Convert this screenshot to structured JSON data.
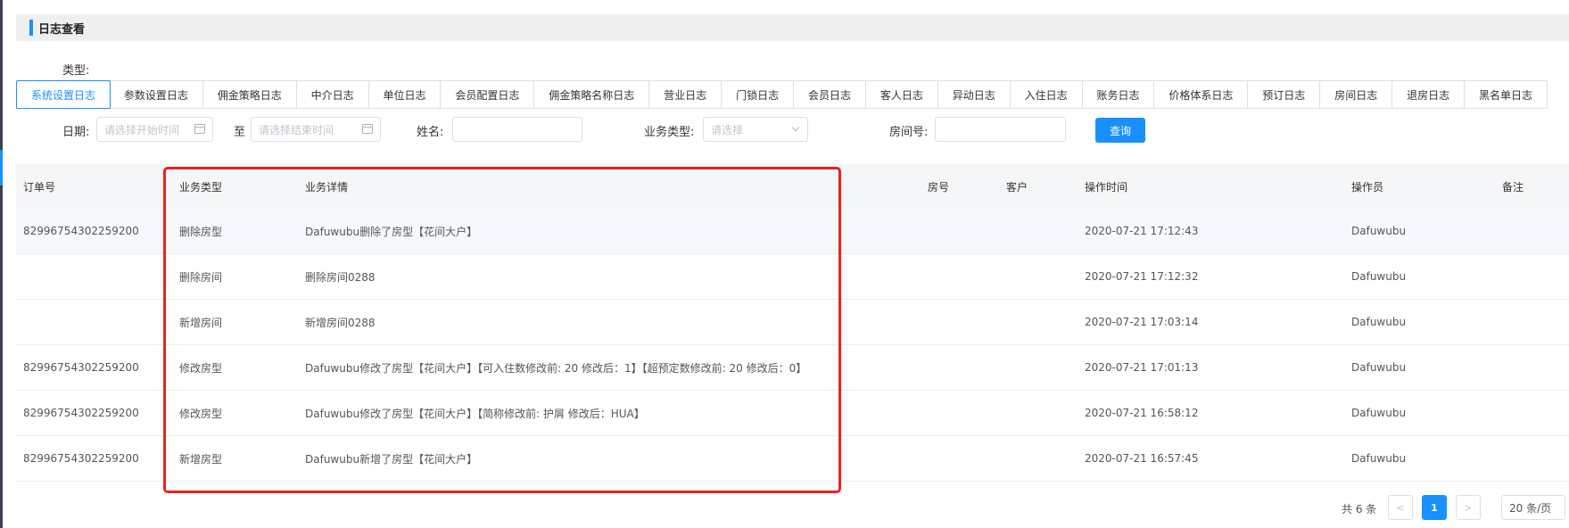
{
  "header": {
    "title": "日志查看"
  },
  "type_filter": {
    "label": "类型:",
    "tabs": [
      "系统设置日志",
      "参数设置日志",
      "佣金策略日志",
      "中介日志",
      "单位日志",
      "会员配置日志",
      "佣金策略名称日志",
      "营业日志",
      "门锁日志",
      "会员日志",
      "客人日志",
      "异动日志",
      "入住日志",
      "账务日志",
      "价格体系日志",
      "预订日志",
      "房间日志",
      "退房日志",
      "黑名单日志"
    ],
    "active": "系统设置日志"
  },
  "filters": {
    "date_label": "日期:",
    "start_placeholder": "请选择开始时间",
    "to_label": "至",
    "end_placeholder": "请选择结束时间",
    "name_label": "姓名:",
    "name_value": "",
    "biz_type_label": "业务类型:",
    "biz_type_placeholder": "请选择",
    "room_label": "房间号:",
    "room_value": "",
    "query_button": "查询"
  },
  "table": {
    "columns": [
      "订单号",
      "业务类型",
      "业务详情",
      "房号",
      "客户",
      "操作时间",
      "操作员",
      "备注"
    ],
    "rows": [
      {
        "order": "82996754302259200",
        "type": "删除房型",
        "detail": "Dafuwubu删除了房型【花间大户】",
        "room": "",
        "customer": "",
        "time": "2020-07-21 17:12:43",
        "operator": "Dafuwubu",
        "remark": ""
      },
      {
        "order": "",
        "type": "删除房间",
        "detail": "删除房间0288",
        "room": "",
        "customer": "",
        "time": "2020-07-21 17:12:32",
        "operator": "Dafuwubu",
        "remark": ""
      },
      {
        "order": "",
        "type": "新增房间",
        "detail": "新增房间0288",
        "room": "",
        "customer": "",
        "time": "2020-07-21 17:03:14",
        "operator": "Dafuwubu",
        "remark": ""
      },
      {
        "order": "82996754302259200",
        "type": "修改房型",
        "detail": "Dafuwubu修改了房型【花间大户】【可入住数修改前: 20 修改后：1】【超预定数修改前: 20 修改后：0】",
        "room": "",
        "customer": "",
        "time": "2020-07-21 17:01:13",
        "operator": "Dafuwubu",
        "remark": ""
      },
      {
        "order": "82996754302259200",
        "type": "修改房型",
        "detail": "Dafuwubu修改了房型【花间大户】【简称修改前: 护屑 修改后：HUA】",
        "room": "",
        "customer": "",
        "time": "2020-07-21 16:58:12",
        "operator": "Dafuwubu",
        "remark": ""
      },
      {
        "order": "82996754302259200",
        "type": "新增房型",
        "detail": "Dafuwubu新增了房型【花间大户】",
        "room": "",
        "customer": "",
        "time": "2020-07-21 16:57:45",
        "operator": "Dafuwubu",
        "remark": ""
      }
    ]
  },
  "pagination": {
    "total_text": "共 6 条",
    "prev": "<",
    "current_page": "1",
    "next": ">",
    "page_size": "20 条/页"
  },
  "colors": {
    "accent": "#1890ff",
    "highlight_border": "#e8231d"
  }
}
